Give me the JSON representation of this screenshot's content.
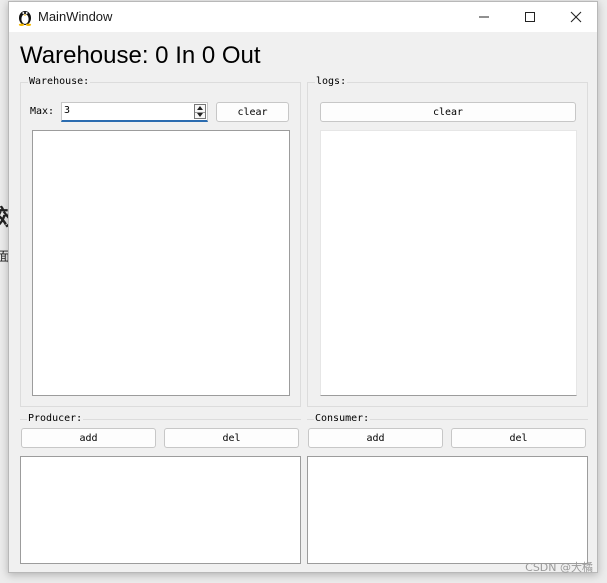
{
  "background": {
    "partial_glyph_1": "效",
    "partial_glyph_2": "面"
  },
  "watermark": "CSDN @大橘",
  "window": {
    "title": "MainWindow",
    "icon": "penguin-icon",
    "controls": [
      "minimize-icon",
      "maximize-icon",
      "close-icon"
    ]
  },
  "heading": "Warehouse: 0 In 0 Out",
  "warehouse_group": {
    "title": "Warehouse:",
    "max_label": "Max:",
    "max_value": "3",
    "clear_label": "clear",
    "items": []
  },
  "logs_group": {
    "title": "logs:",
    "clear_label": "clear",
    "items": []
  },
  "producer_group": {
    "title": "Producer:",
    "add_label": "add",
    "del_label": "del",
    "items": []
  },
  "consumer_group": {
    "title": "Consumer:",
    "add_label": "add",
    "del_label": "del",
    "items": []
  },
  "colors": {
    "window_bg": "#f0f0f0",
    "titlebar_bg": "#ffffff",
    "focus_accent": "#2b6cb0"
  }
}
